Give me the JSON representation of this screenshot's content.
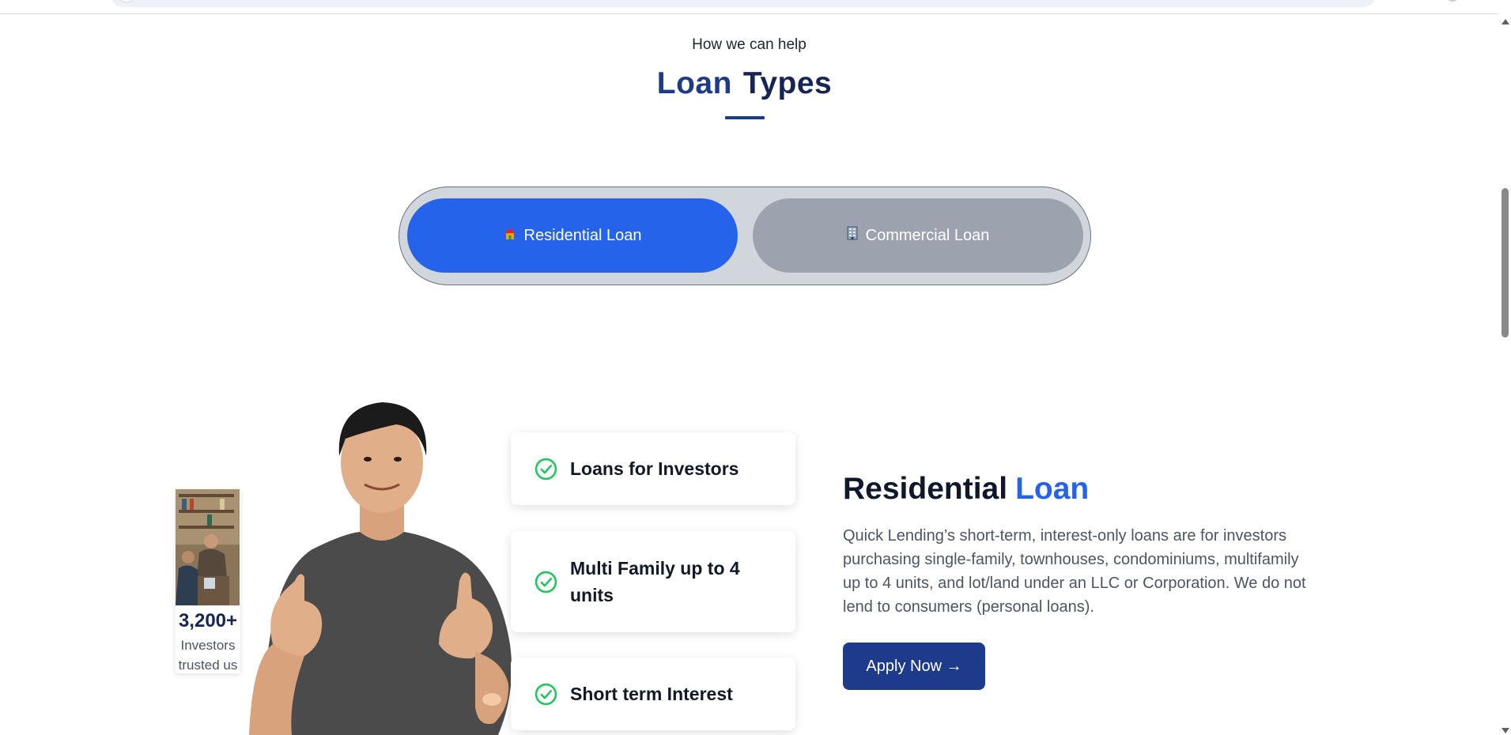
{
  "section": {
    "eyebrow": "How we can help",
    "title_part1": "Loan",
    "title_part2": "Types"
  },
  "toggle": {
    "residential_label": "Residential Loan",
    "commercial_label": "Commercial Loan",
    "active": "residential"
  },
  "stats": {
    "count": "3,200+",
    "label": "Investors trusted us"
  },
  "features": [
    {
      "label": "Loans for Investors"
    },
    {
      "label": "Multi Family up to 4 units"
    },
    {
      "label": "Short term Interest"
    }
  ],
  "detail": {
    "title_part1": "Residential",
    "title_part2": "Loan",
    "description": "Quick Lending’s short-term, interest-only loans are for investors purchasing single-family, townhouses, condominiums, multifamily up to 4 units, and lot/land under an LLC or Corporation. We do not lend to consumers (personal loans).",
    "apply_label": "Apply Now →"
  },
  "colors": {
    "primary_blue": "#2563eb",
    "navy": "#1e3a8a",
    "inactive_gray": "#9ca3af",
    "check_green": "#22c55e"
  },
  "icons": {
    "residential": "house-icon",
    "commercial": "building-icon",
    "feature": "check-circle-icon"
  }
}
